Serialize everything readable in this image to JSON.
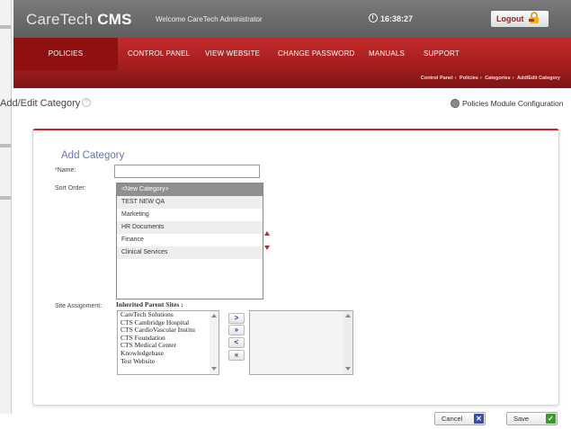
{
  "header": {
    "brand_light": "CareTech",
    "brand_bold": "CMS",
    "welcome": "Welcome CareTech Administrator",
    "time": "16:38:27",
    "logout_label": "Logout"
  },
  "nav": {
    "tabs": [
      {
        "label": "POLICIES",
        "active": true
      },
      {
        "label": "CONTROL PANEL"
      },
      {
        "label": "VIEW WEBSITE"
      },
      {
        "label": "CHANGE PASSWORD"
      },
      {
        "label": "MANUALS"
      },
      {
        "label": "SUPPORT"
      }
    ]
  },
  "breadcrumb": [
    "Control Panel",
    "Policies",
    "Categories",
    "Add/Edit Category"
  ],
  "page": {
    "title": "Add/Edit Category",
    "config_link": "Policies Module Configuration"
  },
  "form": {
    "section_title": "Add Category",
    "name_label": "Name:",
    "name_required_mark": "*",
    "name_value": "",
    "sort_order_label": "Sort Order:",
    "sort_options": [
      {
        "label": "<New Category>",
        "selected": true
      },
      {
        "label": "TEST NEW QA"
      },
      {
        "label": "Marketing"
      },
      {
        "label": "HR Documents"
      },
      {
        "label": "Finance"
      },
      {
        "label": "Clinical Services"
      }
    ],
    "site_assignment_label": "Site Assignment:",
    "inherited_title": "Inherited Parent Sites :",
    "sites": [
      "CareTech Solutions",
      "CTS Cambridge Hospital",
      "CTS CardioVascular Institu",
      "CTS Foundation",
      "CTS Medical Center",
      "Knowledgebase",
      "Test Website"
    ],
    "transfer_buttons": [
      ">",
      "»",
      "<",
      "«"
    ]
  },
  "buttons": {
    "cancel": "Cancel",
    "save": "Save"
  },
  "colors": {
    "accent_red": "#c22929",
    "nav_red": "#a01b1b",
    "cancel_icon": "#3a4fa0",
    "save_icon": "#3a9a2a"
  },
  "icons": {
    "clock": "clock-icon",
    "logout": "lock-icon",
    "help": "help-icon",
    "config": "gear-icon"
  }
}
